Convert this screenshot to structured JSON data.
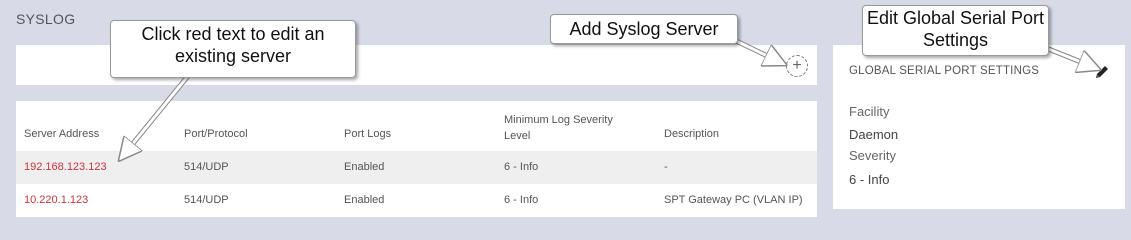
{
  "page": {
    "title": "SYSLOG"
  },
  "toolbar": {
    "add_icon_glyph": "+"
  },
  "table": {
    "headers": [
      "Server Address",
      "Port/Protocol",
      "Port Logs",
      "Minimum Log Severity Level",
      "Description"
    ],
    "rows": [
      {
        "address": "192.168.123.123",
        "port_protocol": "514/UDP",
        "port_logs": "Enabled",
        "severity": "6 - Info",
        "description": "-"
      },
      {
        "address": "10.220.1.123",
        "port_protocol": "514/UDP",
        "port_logs": "Enabled",
        "severity": "6 - Info",
        "description": "SPT Gateway PC (VLAN IP)"
      }
    ]
  },
  "settings": {
    "title": "GLOBAL SERIAL PORT SETTINGS",
    "facility_label": "Facility",
    "facility_value": "Daemon",
    "severity_label": "Severity",
    "severity_value": "6 - Info"
  },
  "callouts": {
    "edit_server": "Click red text to edit an existing server",
    "add_server": "Add Syslog Server",
    "edit_global": "Edit Global Serial Port Settings"
  },
  "colors": {
    "link_red": "#d0323a",
    "background": "#d9dae8"
  },
  "icons": {
    "add": "add-circle-icon",
    "edit": "pencil-icon"
  }
}
